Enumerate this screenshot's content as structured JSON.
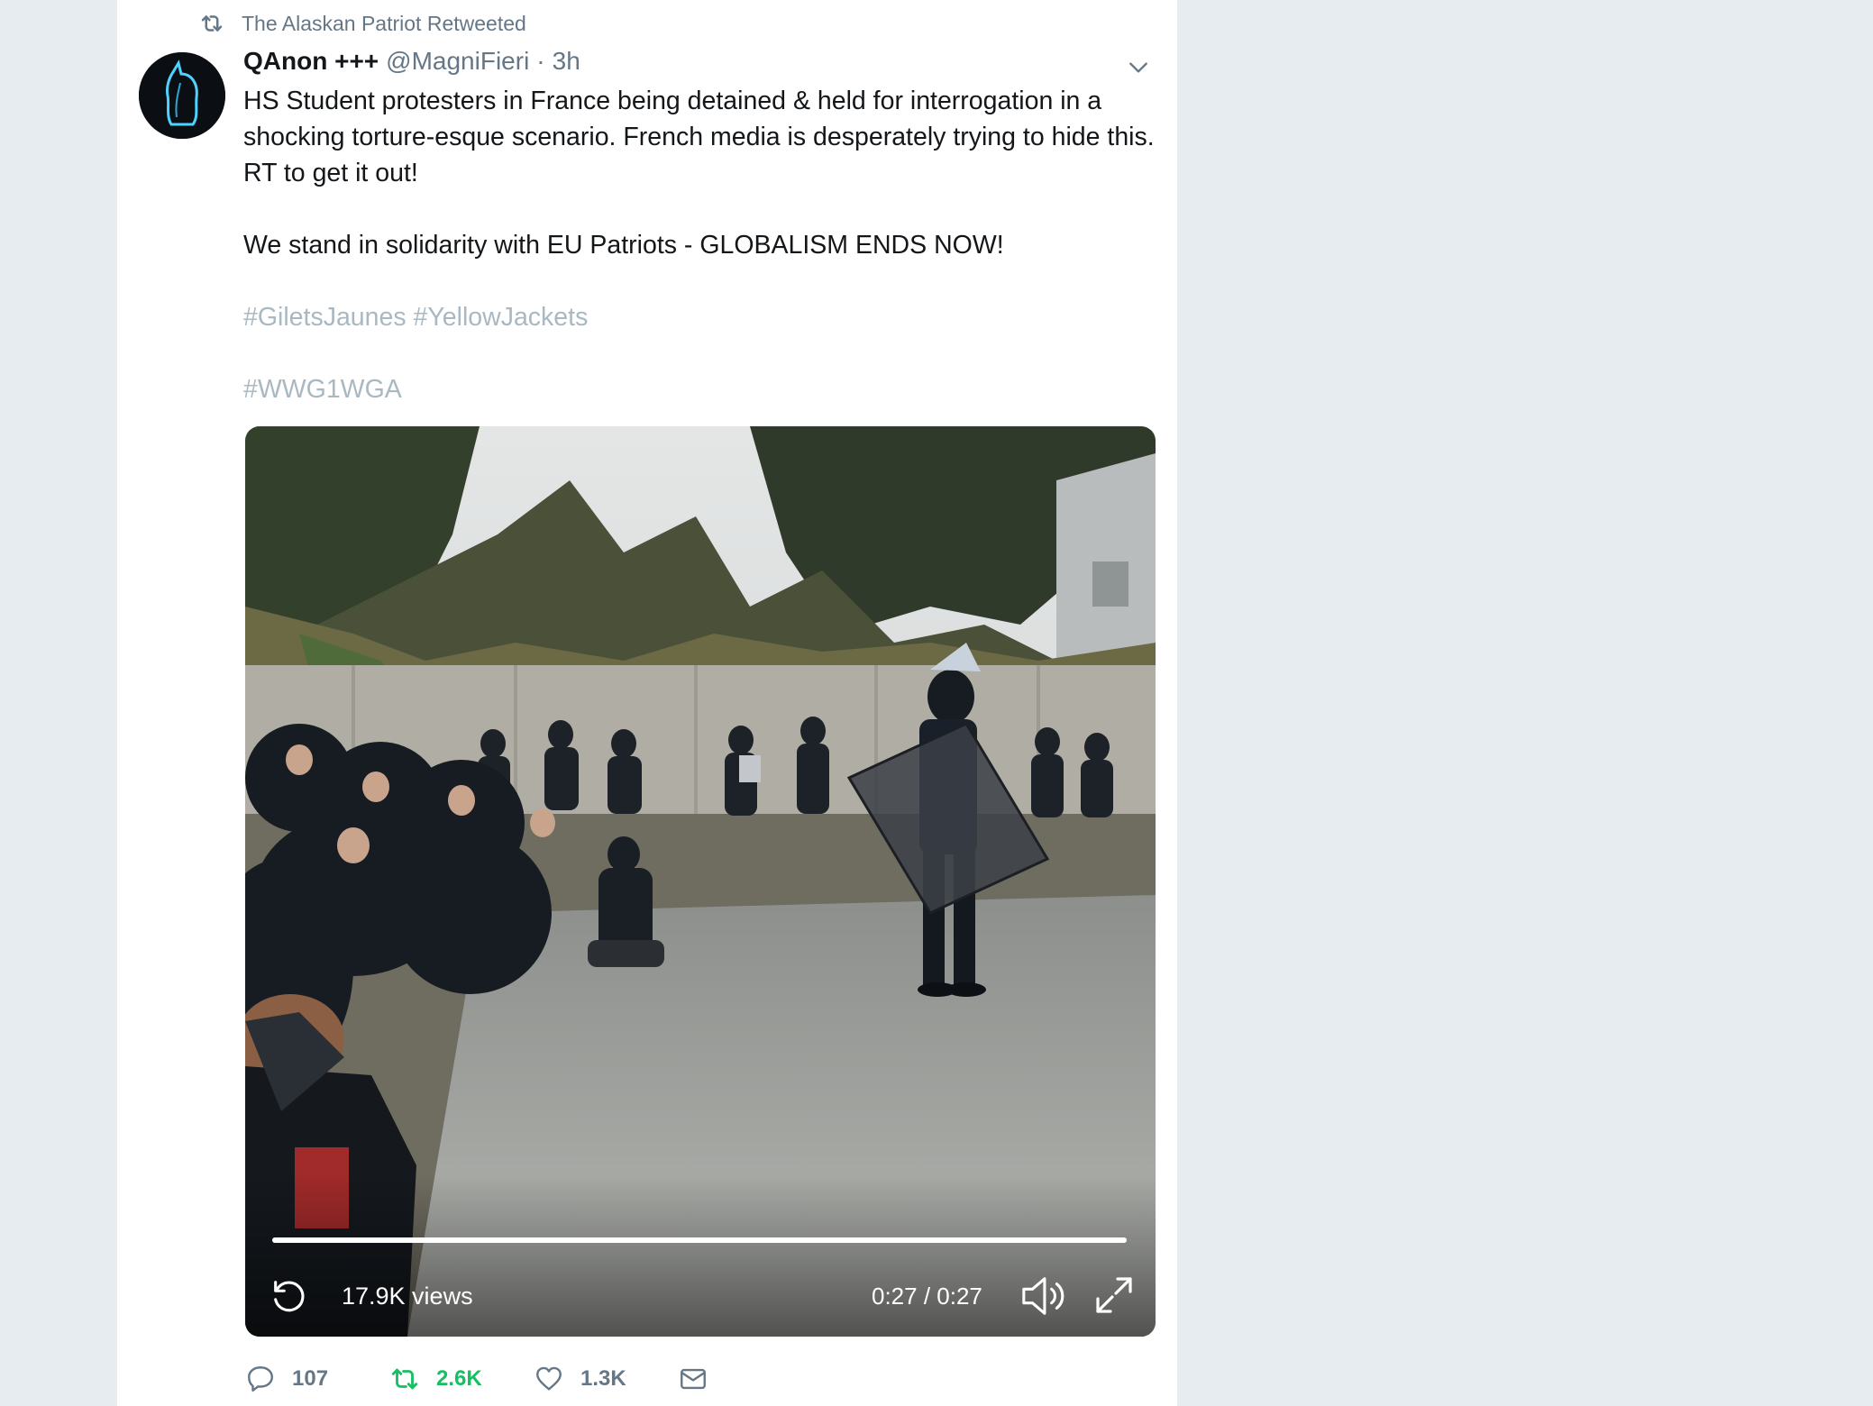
{
  "retweet_banner": {
    "text": "The Alaskan Patriot Retweeted"
  },
  "tweet": {
    "author_name": "QAnon +++",
    "author_handle": "@MagniFieri",
    "separator": "·",
    "time": "3h",
    "paragraphs": [
      "HS Student protesters in France being detained & held for interrogation in a shocking torture-esque scenario. French media is desperately trying to hide this. RT to get it out!",
      "We stand in solidarity with EU Patriots - GLOBALISM ENDS NOW!"
    ],
    "hashtags_line1": "#GiletsJaunes #YellowJackets",
    "hashtags_line2": "#WWG1WGA"
  },
  "video": {
    "views": "17.9K views",
    "time_display": "0:27 / 0:27",
    "progress": 1.0
  },
  "actions": {
    "replies": "107",
    "retweets": "2.6K",
    "likes": "1.3K"
  },
  "colors": {
    "retweet_active": "#17bf63",
    "muted_text": "#657786",
    "hashtag": "#aab8c2"
  }
}
